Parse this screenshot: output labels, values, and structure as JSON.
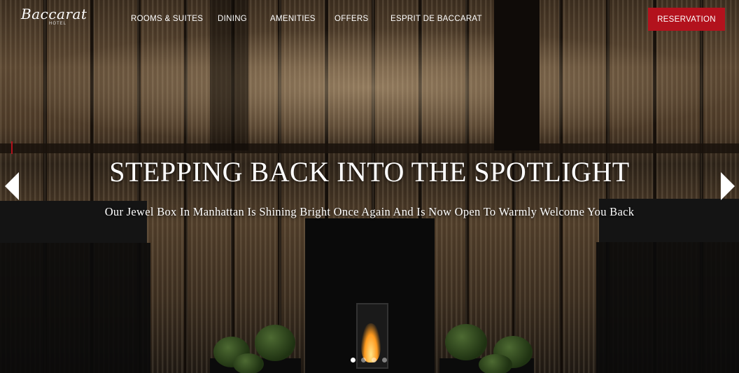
{
  "brand": {
    "name": "Baccarat",
    "sub": "HOTEL"
  },
  "nav": {
    "items": [
      "ROOMS & SUITES",
      "DINING",
      "AMENITIES",
      "OFFERS",
      "ESPRIT DE BACCARAT"
    ]
  },
  "reservation": {
    "label": "RESERVATION",
    "color": "#b3121d"
  },
  "hero": {
    "headline": "STEPPING BACK INTO THE SPOTLIGHT",
    "subheadline": "Our Jewel Box In Manhattan Is Shining Bright Once Again And Is Now Open To Warmly Welcome You Back"
  },
  "carousel": {
    "slides": 4,
    "active_index": 0
  },
  "icons": {
    "prev": "chevron-left-icon",
    "next": "chevron-right-icon"
  }
}
